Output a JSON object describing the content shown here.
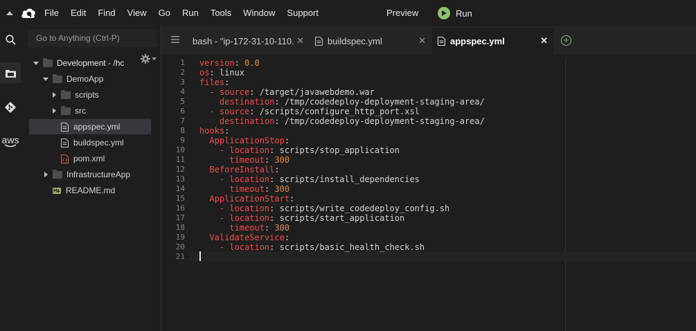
{
  "menubar": {
    "items": [
      "File",
      "Edit",
      "Find",
      "View",
      "Go",
      "Run",
      "Tools",
      "Window",
      "Support"
    ],
    "preview_label": "Preview",
    "run_label": "Run",
    "collapse_icon": "chevron-up-icon",
    "logo_icon": "cloud9-logo-icon",
    "run_icon": "play-icon"
  },
  "rail": {
    "items": [
      {
        "name": "search",
        "icon": "search-icon"
      },
      {
        "name": "environment",
        "icon": "file-explorer-icon"
      },
      {
        "name": "source-control",
        "icon": "git-icon"
      },
      {
        "name": "aws",
        "icon": "aws-icon",
        "label": "aws"
      }
    ]
  },
  "sidebar": {
    "goto_placeholder": "Go to Anything (Ctrl-P)",
    "tree": [
      {
        "label": "Development - /hc",
        "depth": 0,
        "type": "folder",
        "expanded": true
      },
      {
        "label": "DemoApp",
        "depth": 1,
        "type": "folder",
        "expanded": true
      },
      {
        "label": "scripts",
        "depth": 2,
        "type": "folder",
        "expanded": false
      },
      {
        "label": "src",
        "depth": 2,
        "type": "folder",
        "expanded": false
      },
      {
        "label": "appspec.yml",
        "depth": 2,
        "type": "yaml",
        "selected": true
      },
      {
        "label": "buildspec.yml",
        "depth": 2,
        "type": "yaml"
      },
      {
        "label": "pom.xml",
        "depth": 2,
        "type": "xml"
      },
      {
        "label": "InfrastructureApp",
        "depth": 1,
        "type": "folder",
        "expanded": false
      },
      {
        "label": "README.md",
        "depth": 1,
        "type": "markdown"
      }
    ]
  },
  "tabs": [
    {
      "label": "bash - \"ip-172-31-10-110.",
      "active": false
    },
    {
      "label": "buildspec.yml",
      "active": false
    },
    {
      "label": "appspec.yml",
      "active": true
    }
  ],
  "editor": {
    "lines": [
      {
        "n": "1",
        "tokens": [
          [
            "k",
            "version"
          ],
          [
            "v",
            ": "
          ],
          [
            "n",
            "0.0"
          ]
        ]
      },
      {
        "n": "2",
        "tokens": [
          [
            "k",
            "os"
          ],
          [
            "v",
            ": linux"
          ]
        ]
      },
      {
        "n": "3",
        "tokens": [
          [
            "k",
            "files"
          ],
          [
            "v",
            ":"
          ]
        ]
      },
      {
        "n": "4",
        "tokens": [
          [
            "v",
            "  "
          ],
          [
            "k",
            "- source"
          ],
          [
            "v",
            ": /target/javawebdemo.war"
          ]
        ]
      },
      {
        "n": "5",
        "tokens": [
          [
            "v",
            "    "
          ],
          [
            "k",
            "destination"
          ],
          [
            "v",
            ": /tmp/codedeploy-deployment-staging-area/"
          ]
        ]
      },
      {
        "n": "6",
        "tokens": [
          [
            "v",
            "  "
          ],
          [
            "k",
            "- source"
          ],
          [
            "v",
            ": /scripts/configure_http_port.xsl"
          ]
        ]
      },
      {
        "n": "7",
        "tokens": [
          [
            "v",
            "    "
          ],
          [
            "k",
            "destination"
          ],
          [
            "v",
            ": /tmp/codedeploy-deployment-staging-area/"
          ]
        ]
      },
      {
        "n": "8",
        "tokens": [
          [
            "k",
            "hooks"
          ],
          [
            "v",
            ":"
          ]
        ]
      },
      {
        "n": "9",
        "tokens": [
          [
            "v",
            "  "
          ],
          [
            "k",
            "ApplicationStop"
          ],
          [
            "v",
            ":"
          ]
        ]
      },
      {
        "n": "10",
        "tokens": [
          [
            "v",
            "    "
          ],
          [
            "k",
            "- location"
          ],
          [
            "v",
            ": scripts/stop_application"
          ]
        ]
      },
      {
        "n": "11",
        "tokens": [
          [
            "v",
            "      "
          ],
          [
            "k",
            "timeout"
          ],
          [
            "v",
            ": "
          ],
          [
            "n",
            "300"
          ]
        ]
      },
      {
        "n": "12",
        "tokens": [
          [
            "v",
            "  "
          ],
          [
            "k",
            "BeforeInstall"
          ],
          [
            "v",
            ":"
          ]
        ]
      },
      {
        "n": "13",
        "tokens": [
          [
            "v",
            "    "
          ],
          [
            "k",
            "- location"
          ],
          [
            "v",
            ": scripts/install_dependencies"
          ]
        ]
      },
      {
        "n": "14",
        "tokens": [
          [
            "v",
            "      "
          ],
          [
            "k",
            "timeout"
          ],
          [
            "v",
            ": "
          ],
          [
            "n",
            "300"
          ]
        ]
      },
      {
        "n": "15",
        "tokens": [
          [
            "v",
            "  "
          ],
          [
            "k",
            "ApplicationStart"
          ],
          [
            "v",
            ":"
          ]
        ]
      },
      {
        "n": "16",
        "tokens": [
          [
            "v",
            "    "
          ],
          [
            "k",
            "- location"
          ],
          [
            "v",
            ": scripts/write_codedeploy_config.sh"
          ]
        ]
      },
      {
        "n": "17",
        "tokens": [
          [
            "v",
            "    "
          ],
          [
            "k",
            "- location"
          ],
          [
            "v",
            ": scripts/start_application"
          ]
        ]
      },
      {
        "n": "18",
        "tokens": [
          [
            "v",
            "      "
          ],
          [
            "k",
            "timeout"
          ],
          [
            "v",
            ": "
          ],
          [
            "n",
            "300"
          ]
        ]
      },
      {
        "n": "19",
        "tokens": [
          [
            "v",
            "  "
          ],
          [
            "k",
            "ValidateService"
          ],
          [
            "v",
            ":"
          ]
        ]
      },
      {
        "n": "20",
        "tokens": [
          [
            "v",
            "    "
          ],
          [
            "k",
            "- location"
          ],
          [
            "v",
            ": scripts/basic_health_check.sh"
          ]
        ]
      },
      {
        "n": "21",
        "tokens": []
      }
    ]
  },
  "colors": {
    "accent": "#8dc26f",
    "key": "#f24d4d",
    "number": "#e98a3a"
  }
}
